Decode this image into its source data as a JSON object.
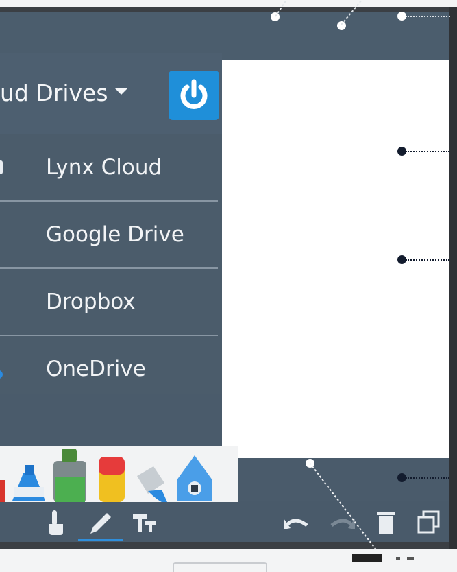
{
  "drives_menu": {
    "title": "ud Drives",
    "items": [
      {
        "label": "Lynx Cloud",
        "icon": "lynx-cloud-icon"
      },
      {
        "label": "Google Drive",
        "icon": "google-drive-icon"
      },
      {
        "label": "Dropbox",
        "icon": "dropbox-icon"
      },
      {
        "label": "OneDrive",
        "icon": "onedrive-icon"
      }
    ]
  },
  "toolbar": {
    "tools": [
      "touch-hand-icon",
      "pen-icon",
      "text-tool-icon"
    ],
    "actions": [
      "undo-icon",
      "redo-icon",
      "trash-icon",
      "copy-icon"
    ]
  },
  "palette": {
    "markers": [
      "red-marker-icon",
      "blue-bottle-icon",
      "green-bottle-icon",
      "yellow-marker-icon",
      "paint-bucket-icon",
      "ink-pot-icon"
    ]
  },
  "colors": {
    "accent": "#1f8fd9",
    "panel": "#4b5c6b",
    "canvas": "#ffffff",
    "callout_dark": "#131c2e"
  }
}
